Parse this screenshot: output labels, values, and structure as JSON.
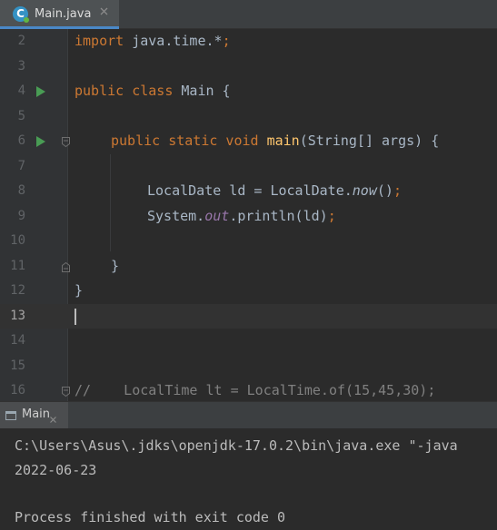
{
  "tab": {
    "title": "Main.java",
    "icon": "java-class-icon"
  },
  "editor": {
    "lines": [
      {
        "n": "2"
      },
      {
        "n": "3"
      },
      {
        "n": "4"
      },
      {
        "n": "5"
      },
      {
        "n": "6"
      },
      {
        "n": "7"
      },
      {
        "n": "8"
      },
      {
        "n": "9"
      },
      {
        "n": "10"
      },
      {
        "n": "11"
      },
      {
        "n": "12"
      },
      {
        "n": "13"
      },
      {
        "n": "14"
      },
      {
        "n": "15"
      },
      {
        "n": "16"
      }
    ],
    "current_line": "13",
    "code": {
      "l2_import": "import",
      "l2_pkg": " java.time.*",
      "l2_semi": ";",
      "l4_public": "public",
      "l4_class": " class",
      "l4_rest": " Main {",
      "l6_mods": "public static void",
      "l6_name": "main",
      "l6_params": "(String[] args) {",
      "l8_decl": "LocalDate ld = LocalDate.",
      "l8_now": "now",
      "l8_call": "()",
      "l8_semi": ";",
      "l9_sys": "System.",
      "l9_out": "out",
      "l9_rest": ".println(ld)",
      "l9_semi": ";",
      "l11_close": "}",
      "l12_close": "}",
      "l16_comment": "//    LocalTime lt = LocalTime.of(15,45,30);"
    }
  },
  "run": {
    "tab_label": "Main",
    "console": [
      "C:\\Users\\Asus\\.jdks\\openjdk-17.0.2\\bin\\java.exe \"-java",
      "2022-06-23",
      "",
      "Process finished with exit code 0"
    ]
  },
  "colors": {
    "editor_bg": "#2b2b2b",
    "gutter_bg": "#313335",
    "keyword": "#cc7832",
    "static_field": "#9876aa",
    "method_decl": "#ffc66d",
    "comment": "#808080",
    "run_green": "#499c54"
  }
}
